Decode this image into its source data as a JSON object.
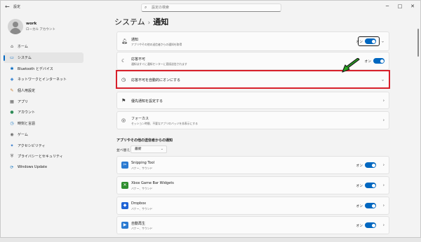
{
  "window": {
    "app_title": "設定",
    "controls": [
      "─",
      "□",
      "✕"
    ]
  },
  "user": {
    "name": "work",
    "account_type": "ローカル アカウント"
  },
  "search": {
    "placeholder": "設定の検索"
  },
  "sidebar": {
    "items": [
      {
        "label": "ホーム",
        "icon": "home-icon",
        "glyph": "⌂",
        "color": "#444444"
      },
      {
        "label": "システム",
        "icon": "system-icon",
        "glyph": "▭",
        "color": "#0067c0",
        "active": true
      },
      {
        "label": "Bluetooth とデバイス",
        "icon": "bluetooth-icon",
        "glyph": "✱",
        "color": "#0067c0"
      },
      {
        "label": "ネットワークとインターネット",
        "icon": "network-icon",
        "glyph": "◆",
        "color": "#4a8fd6"
      },
      {
        "label": "個人用設定",
        "icon": "brush-icon",
        "glyph": "✎",
        "color": "#c77b2d"
      },
      {
        "label": "アプリ",
        "icon": "apps-icon",
        "glyph": "▦",
        "color": "#555555"
      },
      {
        "label": "アカウント",
        "icon": "account-icon",
        "glyph": "●",
        "color": "#2e8b57"
      },
      {
        "label": "時刻と言語",
        "icon": "time-language-icon",
        "glyph": "◷",
        "color": "#1c7ac2"
      },
      {
        "label": "ゲーム",
        "icon": "gaming-icon",
        "glyph": "◉",
        "color": "#666666"
      },
      {
        "label": "アクセシビリティ",
        "icon": "accessibility-icon",
        "glyph": "✦",
        "color": "#2a73c9"
      },
      {
        "label": "プライバシーとセキュリティ",
        "icon": "shield-icon",
        "glyph": "⛨",
        "color": "#555555"
      },
      {
        "label": "Windows Update",
        "icon": "windows-update-icon",
        "glyph": "⟳",
        "color": "#1c7ac2"
      }
    ]
  },
  "breadcrumb": {
    "parent": "システム",
    "separator": "›",
    "current": "通知"
  },
  "cards": {
    "notifications": {
      "title": "通知",
      "subtitle": "アプリやその他の送信者からの通知を取得",
      "toggle_label": "オン"
    },
    "dnd": {
      "title": "応答不可",
      "subtitle": "通知はすぐに通知センターに直接送信されます",
      "toggle_label": "オン"
    },
    "auto_dnd": {
      "title": "応答不可を自動的にオンにする"
    },
    "priority": {
      "title": "優先通知を設定する"
    },
    "focus": {
      "title": "フォーカス",
      "subtitle": "セッション時間、不要なアプリのバッジを非表示にする"
    }
  },
  "apps_section": {
    "heading": "アプリやその他の送信者からの通知",
    "sort_label": "並べ替え:",
    "sort_value": "最新",
    "apps": [
      {
        "name": "Snipping Tool",
        "subtitle": "バナー、サウンド",
        "toggle_label": "オン",
        "icon": "snipping-tool-icon",
        "color": "#2a7ad1",
        "glyph": "✂"
      },
      {
        "name": "Xbox Game Bar Widgets",
        "subtitle": "バナー、サウンド",
        "toggle_label": "オン",
        "icon": "xbox-icon",
        "color": "#2f8f2f",
        "glyph": "✕"
      },
      {
        "name": "Dropbox",
        "subtitle": "バナー、サウンド",
        "toggle_label": "オン",
        "icon": "dropbox-icon",
        "color": "#1f64d6",
        "glyph": "◆"
      },
      {
        "name": "自動再生",
        "subtitle": "バナー、サウンド",
        "toggle_label": "オン",
        "icon": "autoplay-icon",
        "color": "#2a7ad1",
        "glyph": "▶"
      }
    ]
  },
  "accent_color": "#0067c0",
  "annotation_color": "#d8202b",
  "arrow_color": "#27a820"
}
